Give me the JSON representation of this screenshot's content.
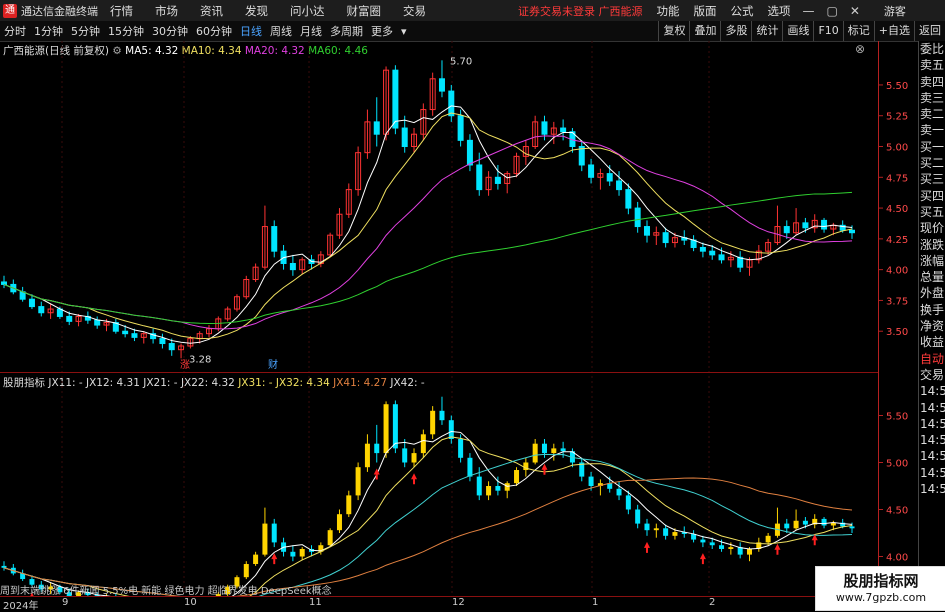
{
  "app": {
    "title": "通达信金融终端"
  },
  "menu": [
    "行情",
    "市场",
    "资讯",
    "发现",
    "问小达",
    "财富圈",
    "交易"
  ],
  "warning": "证券交易未登录  广西能源",
  "right_menu": [
    "功能",
    "版面",
    "公式",
    "选项"
  ],
  "guest": "游客",
  "periods": [
    "分时",
    "1分钟",
    "5分钟",
    "15分钟",
    "30分钟",
    "60分钟",
    "日线",
    "周线",
    "月线",
    "多周期",
    "更多"
  ],
  "active_period": "日线",
  "tools": [
    "复权",
    "叠加",
    "多股",
    "统计",
    "画线",
    "F10",
    "标记",
    "+自选",
    "返回"
  ],
  "upper_legend": {
    "name": "广西能源(日线 前复权)",
    "ma5": "MA5: 4.32",
    "ma10": "MA10: 4.34",
    "ma20": "MA20: 4.32",
    "ma60": "MA60: 4.46"
  },
  "lower_legend": {
    "name": "股朋指标",
    "items": [
      "JX11: -",
      "JX12: 4.31",
      "JX21: -",
      "JX22: 4.32",
      "JX31: -",
      "JX32: 4.34",
      "JX41: 4.27",
      "JX42: -"
    ]
  },
  "upper_axis": [
    "5.50",
    "5.25",
    "5.00",
    "4.75",
    "4.50",
    "4.25",
    "4.00",
    "3.75",
    "3.50"
  ],
  "lower_axis": [
    "5.50",
    "5.00",
    "4.50",
    "4.00"
  ],
  "annotations": {
    "high": "5.70",
    "low": "3.28",
    "tag1": "涨",
    "tag2": "财"
  },
  "sidebar": [
    "委比",
    "卖五",
    "卖四",
    "卖三",
    "卖二",
    "卖一",
    "买一",
    "买二",
    "买三",
    "买四",
    "买五",
    "现价",
    "涨跌",
    "涨幅",
    "总量",
    "外盘",
    "换手",
    "净资",
    "收益",
    "自动",
    "交易",
    "14:56",
    "14:56",
    "14:56",
    "14:56",
    "14:56",
    "14:56",
    "14:56"
  ],
  "ticker": "周到末端跳涨  6件新闻  5.5%电 新能 绿色电力 超临界发电 DeepSeek概念",
  "date_axis": [
    "2024年",
    "9",
    "10",
    "11",
    "12",
    "1",
    "2"
  ],
  "watermark": {
    "line1": "股朋指标网",
    "line2": "www.7gpzb.com"
  },
  "colors": {
    "up": "#ff3333",
    "down": "#00e5ff",
    "ma5": "#ffffff",
    "ma10": "#f0e060",
    "ma20": "#e040e0",
    "ma60": "#30d030",
    "yellow": "#ffd400",
    "arrow": "#ff2020"
  },
  "chart_data": {
    "type": "candlestick",
    "title": "广西能源(日线 前复权)",
    "candles": [
      [
        3.9,
        3.95,
        3.85,
        3.88
      ],
      [
        3.88,
        3.92,
        3.8,
        3.82
      ],
      [
        3.82,
        3.86,
        3.74,
        3.76
      ],
      [
        3.76,
        3.8,
        3.68,
        3.7
      ],
      [
        3.7,
        3.74,
        3.62,
        3.65
      ],
      [
        3.65,
        3.72,
        3.6,
        3.68
      ],
      [
        3.68,
        3.7,
        3.6,
        3.62
      ],
      [
        3.62,
        3.66,
        3.55,
        3.58
      ],
      [
        3.58,
        3.64,
        3.54,
        3.62
      ],
      [
        3.62,
        3.66,
        3.56,
        3.59
      ],
      [
        3.59,
        3.62,
        3.52,
        3.55
      ],
      [
        3.55,
        3.6,
        3.5,
        3.57
      ],
      [
        3.57,
        3.6,
        3.48,
        3.5
      ],
      [
        3.5,
        3.55,
        3.45,
        3.48
      ],
      [
        3.48,
        3.52,
        3.42,
        3.45
      ],
      [
        3.45,
        3.5,
        3.4,
        3.48
      ],
      [
        3.48,
        3.52,
        3.4,
        3.44
      ],
      [
        3.44,
        3.48,
        3.36,
        3.4
      ],
      [
        3.4,
        3.44,
        3.3,
        3.35
      ],
      [
        3.35,
        3.4,
        3.28,
        3.38
      ],
      [
        3.38,
        3.46,
        3.36,
        3.44
      ],
      [
        3.44,
        3.5,
        3.4,
        3.48
      ],
      [
        3.48,
        3.55,
        3.45,
        3.52
      ],
      [
        3.52,
        3.62,
        3.5,
        3.6
      ],
      [
        3.6,
        3.7,
        3.58,
        3.68
      ],
      [
        3.68,
        3.8,
        3.66,
        3.78
      ],
      [
        3.78,
        3.95,
        3.76,
        3.92
      ],
      [
        3.92,
        4.05,
        3.9,
        4.02
      ],
      [
        4.02,
        4.52,
        4.0,
        4.35
      ],
      [
        4.35,
        4.4,
        4.1,
        4.15
      ],
      [
        4.15,
        4.2,
        4.0,
        4.05
      ],
      [
        4.05,
        4.12,
        3.95,
        4.0
      ],
      [
        4.0,
        4.1,
        3.96,
        4.08
      ],
      [
        4.08,
        4.12,
        4.0,
        4.05
      ],
      [
        4.05,
        4.15,
        4.02,
        4.12
      ],
      [
        4.12,
        4.3,
        4.1,
        4.28
      ],
      [
        4.28,
        4.5,
        4.25,
        4.45
      ],
      [
        4.45,
        4.7,
        4.42,
        4.65
      ],
      [
        4.65,
        5.0,
        4.6,
        4.95
      ],
      [
        4.95,
        5.3,
        4.9,
        5.2
      ],
      [
        5.2,
        5.4,
        5.0,
        5.1
      ],
      [
        5.1,
        5.65,
        5.05,
        5.62
      ],
      [
        5.62,
        5.66,
        5.1,
        5.15
      ],
      [
        5.15,
        5.25,
        4.95,
        5.0
      ],
      [
        5.0,
        5.15,
        4.95,
        5.1
      ],
      [
        5.1,
        5.35,
        5.05,
        5.3
      ],
      [
        5.3,
        5.6,
        5.25,
        5.55
      ],
      [
        5.55,
        5.7,
        5.4,
        5.45
      ],
      [
        5.45,
        5.5,
        5.2,
        5.25
      ],
      [
        5.25,
        5.3,
        5.0,
        5.05
      ],
      [
        5.05,
        5.1,
        4.8,
        4.85
      ],
      [
        4.85,
        4.95,
        4.6,
        4.65
      ],
      [
        4.65,
        4.8,
        4.6,
        4.75
      ],
      [
        4.75,
        4.85,
        4.65,
        4.7
      ],
      [
        4.7,
        4.8,
        4.62,
        4.78
      ],
      [
        4.78,
        4.95,
        4.75,
        4.92
      ],
      [
        4.92,
        5.05,
        4.85,
        5.0
      ],
      [
        5.0,
        5.25,
        4.98,
        5.2
      ],
      [
        5.2,
        5.25,
        5.05,
        5.1
      ],
      [
        5.1,
        5.2,
        5.02,
        5.15
      ],
      [
        5.15,
        5.22,
        5.05,
        5.12
      ],
      [
        5.12,
        5.15,
        4.95,
        5.0
      ],
      [
        5.0,
        5.05,
        4.8,
        4.85
      ],
      [
        4.85,
        4.9,
        4.7,
        4.75
      ],
      [
        4.75,
        4.82,
        4.65,
        4.78
      ],
      [
        4.78,
        4.85,
        4.68,
        4.72
      ],
      [
        4.72,
        4.8,
        4.6,
        4.65
      ],
      [
        4.65,
        4.7,
        4.45,
        4.5
      ],
      [
        4.5,
        4.55,
        4.3,
        4.35
      ],
      [
        4.35,
        4.4,
        4.22,
        4.28
      ],
      [
        4.28,
        4.35,
        4.2,
        4.3
      ],
      [
        4.3,
        4.34,
        4.18,
        4.22
      ],
      [
        4.22,
        4.3,
        4.18,
        4.26
      ],
      [
        4.26,
        4.32,
        4.2,
        4.24
      ],
      [
        4.24,
        4.28,
        4.15,
        4.18
      ],
      [
        4.18,
        4.22,
        4.1,
        4.15
      ],
      [
        4.15,
        4.2,
        4.08,
        4.12
      ],
      [
        4.12,
        4.18,
        4.05,
        4.08
      ],
      [
        4.08,
        4.15,
        4.02,
        4.1
      ],
      [
        4.1,
        4.15,
        3.98,
        4.02
      ],
      [
        4.02,
        4.1,
        3.95,
        4.08
      ],
      [
        4.08,
        4.2,
        4.05,
        4.15
      ],
      [
        4.15,
        4.25,
        4.12,
        4.22
      ],
      [
        4.22,
        4.52,
        4.2,
        4.35
      ],
      [
        4.35,
        4.4,
        4.25,
        4.3
      ],
      [
        4.3,
        4.5,
        4.28,
        4.38
      ],
      [
        4.38,
        4.42,
        4.3,
        4.34
      ],
      [
        4.34,
        4.45,
        4.3,
        4.4
      ],
      [
        4.4,
        4.42,
        4.3,
        4.33
      ],
      [
        4.33,
        4.38,
        4.28,
        4.36
      ],
      [
        4.36,
        4.4,
        4.3,
        4.32
      ],
      [
        4.32,
        4.36,
        4.25,
        4.3
      ]
    ],
    "ylim": [
      3.25,
      5.8
    ],
    "high_label": "5.70",
    "low_label": "3.28"
  }
}
